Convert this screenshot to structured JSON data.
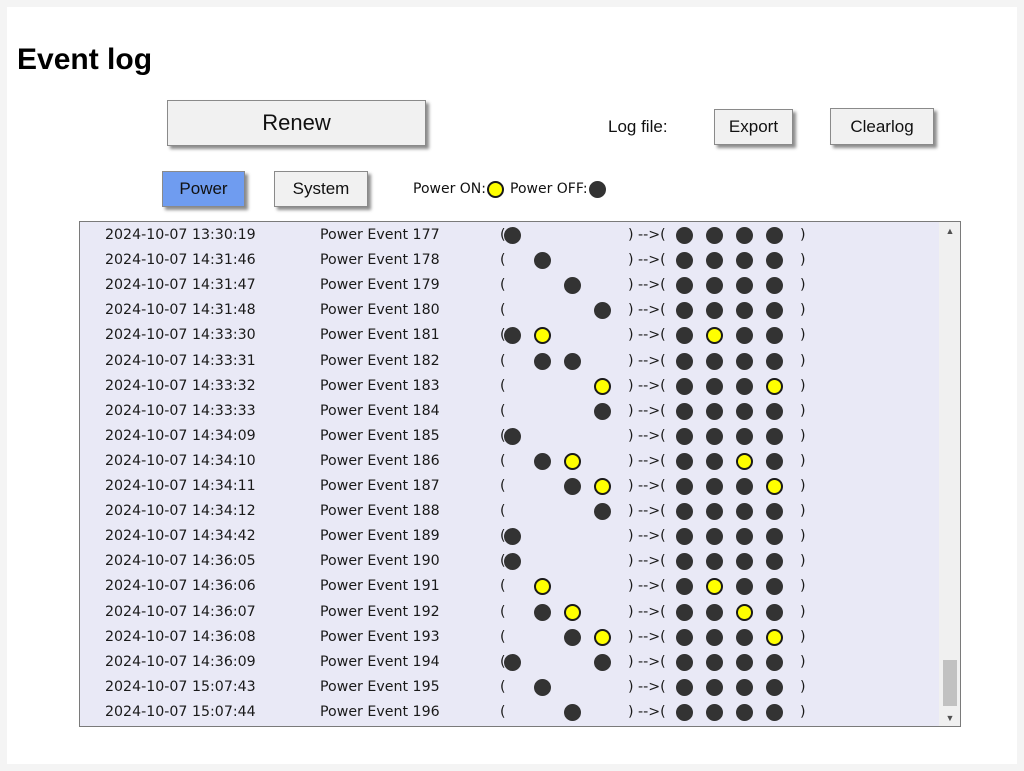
{
  "page": {
    "title": "Event log"
  },
  "toolbar": {
    "renew_label": "Renew",
    "logfile_label": "Log file:",
    "export_label": "Export",
    "clearlog_label": "Clearlog"
  },
  "tabs": {
    "power_label": "Power",
    "system_label": "System",
    "active": "Power"
  },
  "legend": {
    "on_label": "Power ON:",
    "off_label": "Power OFF:"
  },
  "colors": {
    "on": "#ffff00",
    "off": "#333333",
    "active_tab": "#6f9cf0",
    "log_background": "#e9e9f6"
  },
  "log": {
    "arrow": ") -->(",
    "rows": [
      {
        "time": "2024-10-07 13:30:19",
        "event": "Power Event 177",
        "changed": [
          "off",
          null,
          null,
          null
        ],
        "result": [
          "off",
          "off",
          "off",
          "off"
        ]
      },
      {
        "time": "2024-10-07 14:31:46",
        "event": "Power Event 178",
        "changed": [
          null,
          "off",
          null,
          null
        ],
        "result": [
          "off",
          "off",
          "off",
          "off"
        ]
      },
      {
        "time": "2024-10-07 14:31:47",
        "event": "Power Event 179",
        "changed": [
          null,
          null,
          "off",
          null
        ],
        "result": [
          "off",
          "off",
          "off",
          "off"
        ]
      },
      {
        "time": "2024-10-07 14:31:48",
        "event": "Power Event 180",
        "changed": [
          null,
          null,
          null,
          "off"
        ],
        "result": [
          "off",
          "off",
          "off",
          "off"
        ]
      },
      {
        "time": "2024-10-07 14:33:30",
        "event": "Power Event 181",
        "changed": [
          "off",
          "on",
          null,
          null
        ],
        "result": [
          "off",
          "on",
          "off",
          "off"
        ]
      },
      {
        "time": "2024-10-07 14:33:31",
        "event": "Power Event 182",
        "changed": [
          null,
          "off",
          "off",
          null
        ],
        "result": [
          "off",
          "off",
          "off",
          "off"
        ]
      },
      {
        "time": "2024-10-07 14:33:32",
        "event": "Power Event 183",
        "changed": [
          null,
          null,
          null,
          "on"
        ],
        "result": [
          "off",
          "off",
          "off",
          "on"
        ]
      },
      {
        "time": "2024-10-07 14:33:33",
        "event": "Power Event 184",
        "changed": [
          null,
          null,
          null,
          "off"
        ],
        "result": [
          "off",
          "off",
          "off",
          "off"
        ]
      },
      {
        "time": "2024-10-07 14:34:09",
        "event": "Power Event 185",
        "changed": [
          "off",
          null,
          null,
          null
        ],
        "result": [
          "off",
          "off",
          "off",
          "off"
        ]
      },
      {
        "time": "2024-10-07 14:34:10",
        "event": "Power Event 186",
        "changed": [
          null,
          "off",
          "on",
          null
        ],
        "result": [
          "off",
          "off",
          "on",
          "off"
        ]
      },
      {
        "time": "2024-10-07 14:34:11",
        "event": "Power Event 187",
        "changed": [
          null,
          null,
          "off",
          "on"
        ],
        "result": [
          "off",
          "off",
          "off",
          "on"
        ]
      },
      {
        "time": "2024-10-07 14:34:12",
        "event": "Power Event 188",
        "changed": [
          null,
          null,
          null,
          "off"
        ],
        "result": [
          "off",
          "off",
          "off",
          "off"
        ]
      },
      {
        "time": "2024-10-07 14:34:42",
        "event": "Power Event 189",
        "changed": [
          "off",
          null,
          null,
          null
        ],
        "result": [
          "off",
          "off",
          "off",
          "off"
        ]
      },
      {
        "time": "2024-10-07 14:36:05",
        "event": "Power Event 190",
        "changed": [
          "off",
          null,
          null,
          null
        ],
        "result": [
          "off",
          "off",
          "off",
          "off"
        ]
      },
      {
        "time": "2024-10-07 14:36:06",
        "event": "Power Event 191",
        "changed": [
          null,
          "on",
          null,
          null
        ],
        "result": [
          "off",
          "on",
          "off",
          "off"
        ]
      },
      {
        "time": "2024-10-07 14:36:07",
        "event": "Power Event 192",
        "changed": [
          null,
          "off",
          "on",
          null
        ],
        "result": [
          "off",
          "off",
          "on",
          "off"
        ]
      },
      {
        "time": "2024-10-07 14:36:08",
        "event": "Power Event 193",
        "changed": [
          null,
          null,
          "off",
          "on"
        ],
        "result": [
          "off",
          "off",
          "off",
          "on"
        ]
      },
      {
        "time": "2024-10-07 14:36:09",
        "event": "Power Event 194",
        "changed": [
          "off",
          null,
          null,
          "off"
        ],
        "result": [
          "off",
          "off",
          "off",
          "off"
        ]
      },
      {
        "time": "2024-10-07 15:07:43",
        "event": "Power Event 195",
        "changed": [
          null,
          "off",
          null,
          null
        ],
        "result": [
          "off",
          "off",
          "off",
          "off"
        ]
      },
      {
        "time": "2024-10-07 15:07:44",
        "event": "Power Event 196",
        "changed": [
          null,
          null,
          "off",
          null
        ],
        "result": [
          "off",
          "off",
          "off",
          "off"
        ]
      }
    ]
  },
  "scrollbar": {
    "up_icon": "triangle-up",
    "down_icon": "triangle-down"
  }
}
